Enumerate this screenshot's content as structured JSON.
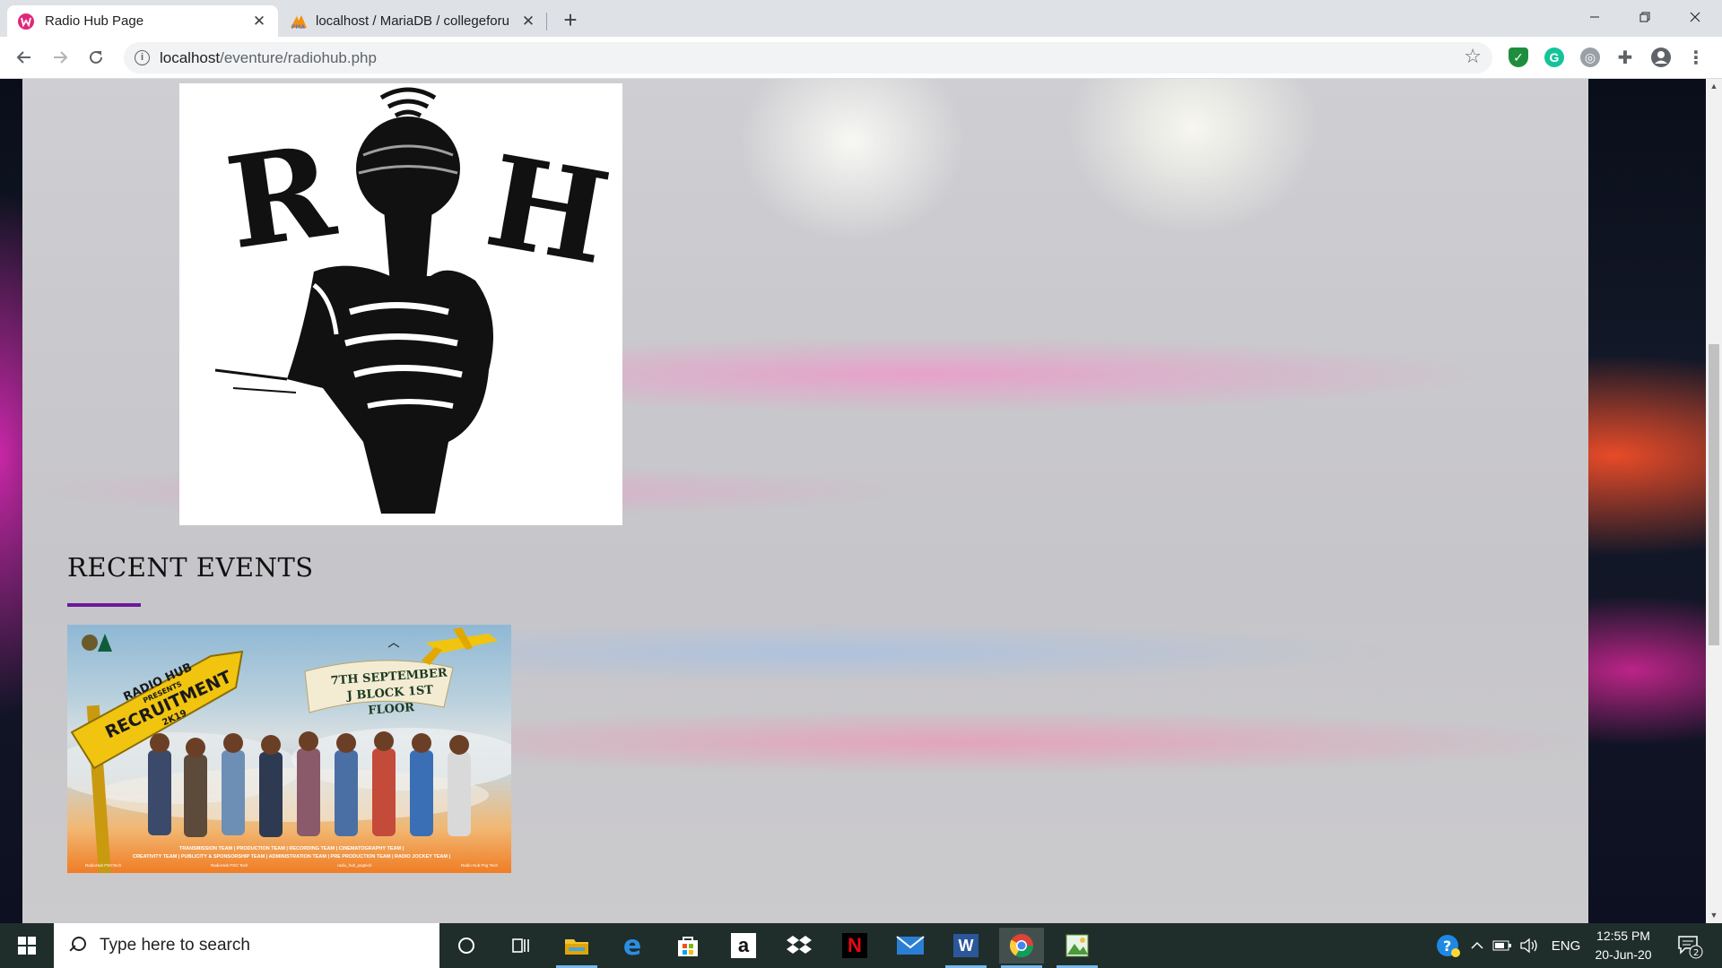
{
  "browser": {
    "tabs": [
      {
        "title": "Radio Hub Page",
        "active": true,
        "favicon": "wamp-icon"
      },
      {
        "title": "localhost / MariaDB / collegeforu",
        "active": false,
        "favicon": "phpmyadmin-icon"
      }
    ],
    "new_tab": "+",
    "url_host": "localhost",
    "url_path": "/eventure/radiohub.php"
  },
  "page": {
    "logo_alt": "Radio Hub logo",
    "logo_letters": [
      "R",
      "H"
    ],
    "recent_events_title": "RECENT EVENTS",
    "poster": {
      "sign_line1": "RADIO HUB",
      "sign_line2": "PRESENTS",
      "sign_line3": "RECRUITMENT",
      "sign_line4": "2K19",
      "date_line1": "7TH SEPTEMBER",
      "date_line2": "J BLOCK 1ST FLOOR",
      "teams_line1": "TRANSMISSION TEAM | PRODUCTION TEAM | RECORDING TEAM | CINEMATOGRAPHY TEAM |",
      "teams_line2": "CREATIVITY TEAM | PUBLICITY & SPONSORSHIP TEAM | ADMINISTRATION TEAM | PRE PRODUCTION TEAM | RADIO JOCKEY TEAM |",
      "footer": [
        "RadioHub PSGTech",
        "RadioHub PSG Tech",
        "radio_hub_psgtech",
        "Radio Hub Psg Tech"
      ]
    }
  },
  "taskbar": {
    "search_placeholder": "Type here to search",
    "language": "ENG",
    "time": "12:55 PM",
    "date": "20-Jun-20",
    "notifications": "2"
  },
  "colors": {
    "accent_underline": "#6a1b9a",
    "taskbar": "#1f2e2b",
    "running_indicator": "#76b9ed"
  }
}
